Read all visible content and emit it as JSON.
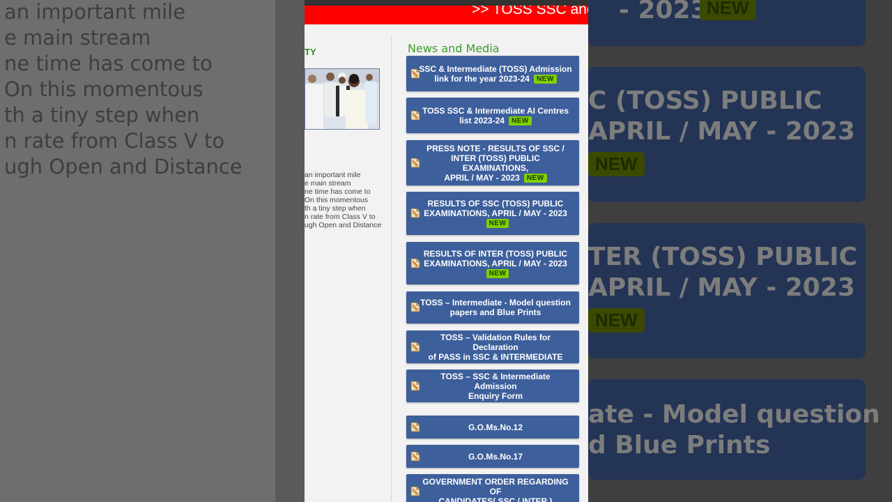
{
  "background_left": {
    "lines": [
      "an important mile",
      "e main stream",
      "ne time has come to",
      "On this momentous",
      "th a tiny step when",
      "n rate from Class V to",
      "ugh Open and Distance"
    ]
  },
  "background_right": {
    "cards": [
      {
        "text": "- 2023",
        "badge": "NEW"
      },
      {
        "line1": "C (TOSS) PUBLIC",
        "line2": "APRIL / MAY - 2023",
        "badge": "NEW"
      },
      {
        "line1": "TER (TOSS) PUBLIC",
        "line2": "APRIL / MAY - 2023",
        "badge": "NEW"
      },
      {
        "line1": "ate - Model question",
        "line2": "d Blue Prints"
      }
    ]
  },
  "marquee": {
    "text": ">> TOSS SSC and"
  },
  "left_column": {
    "heading": "TY",
    "about_lines": [
      "an important mile",
      "e main stream",
      "ne time has come to",
      "On this momentous",
      "th a tiny step when",
      "n rate from Class V to",
      "ugh Open and Distance"
    ]
  },
  "news": {
    "title": "News and Media",
    "badge_label": "NEW",
    "items": [
      {
        "lines": [
          "SSC & Intermediate (TOSS) Admission",
          "link for the year 2023-24"
        ],
        "is_new": true
      },
      {
        "lines": [
          "TOSS SSC & Intermediate AI Centres",
          "list 2023-24"
        ],
        "is_new": true
      },
      {
        "lines": [
          "PRESS NOTE - RESULTS OF SSC /",
          "INTER (TOSS) PUBLIC EXAMINATIONS,",
          "APRIL / MAY - 2023"
        ],
        "is_new": true
      },
      {
        "lines": [
          "RESULTS OF SSC (TOSS) PUBLIC",
          "EXAMINATIONS, APRIL / MAY - 2023"
        ],
        "is_new": true
      },
      {
        "lines": [
          "RESULTS OF INTER (TOSS) PUBLIC",
          "EXAMINATIONS, APRIL / MAY - 2023"
        ],
        "is_new": true
      },
      {
        "lines": [
          "TOSS – Intermediate - Model question",
          "papers and Blue Prints"
        ],
        "is_new": false
      },
      {
        "lines": [
          "TOSS – Validation Rules for Declaration",
          "of PASS in SSC & INTERMEDIATE"
        ],
        "is_new": false
      },
      {
        "lines": [
          "TOSS – SSC & Intermediate Admission",
          "Enquiry Form"
        ],
        "is_new": false
      },
      {
        "lines": [
          "G.O.Ms.No.12"
        ],
        "is_new": false
      },
      {
        "lines": [
          "G.O.Ms.No.17"
        ],
        "is_new": false
      },
      {
        "lines": [
          "GOVERNMENT ORDER REGARDING OF",
          "CANDIDATES( SSC / INTER )"
        ],
        "is_new": false
      }
    ]
  },
  "colors": {
    "marquee_bg": "#ff0000",
    "news_item_bg": "#3d5f9c",
    "news_title": "#3c9a2a",
    "new_badge": "#7fd000"
  },
  "icons": {
    "news_item_icon": "document-icon"
  }
}
